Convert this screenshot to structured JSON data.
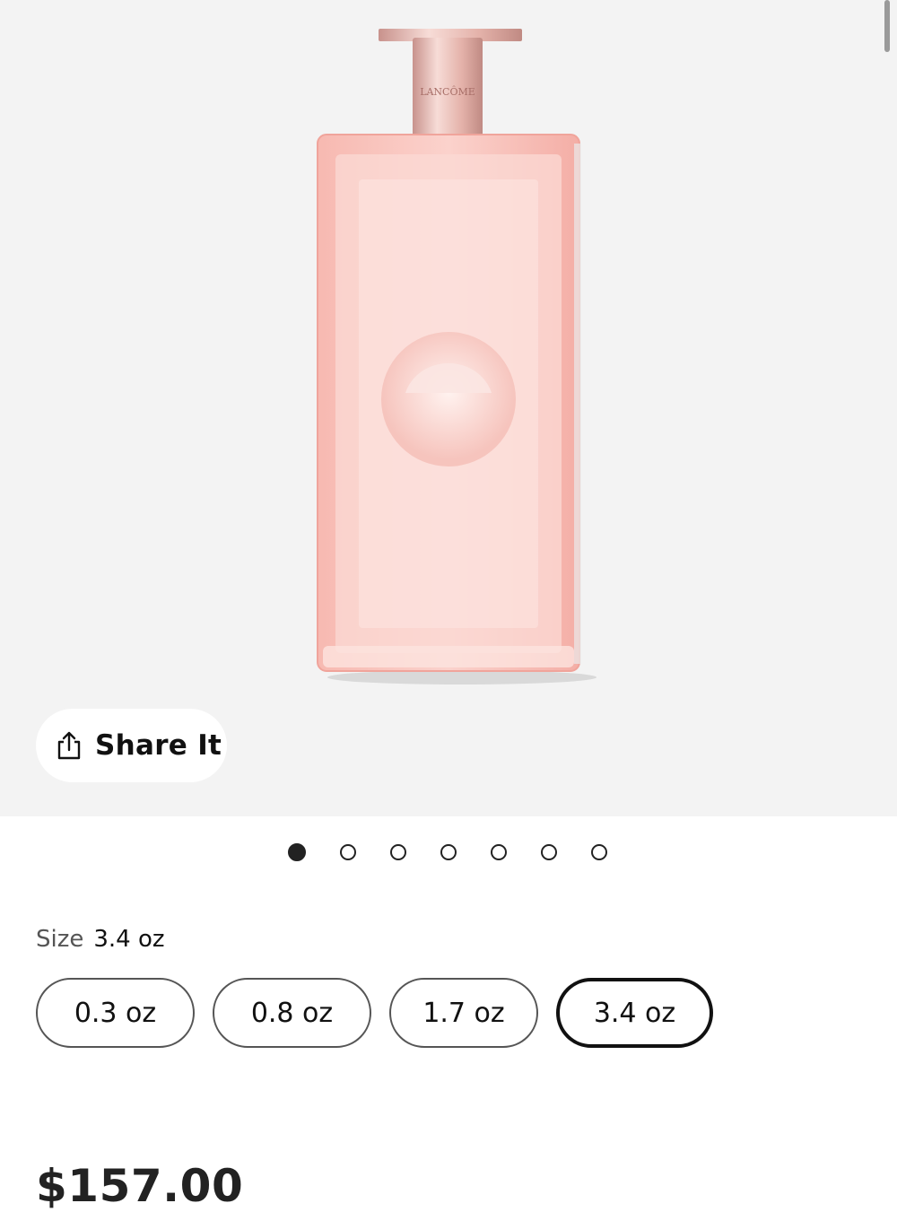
{
  "product": {
    "brand_engraving": "LANCÔME",
    "price": "$157.00"
  },
  "share": {
    "label": "Share It",
    "icon": "share-icon"
  },
  "carousel": {
    "count": 7,
    "active_index": 0
  },
  "size": {
    "label": "Size",
    "selected": "3.4 oz",
    "options": [
      "0.3 oz",
      "0.8 oz",
      "1.7 oz",
      "3.4 oz"
    ]
  },
  "colors": {
    "hero_background": "#f3f3f3",
    "bottle_pink": "#f6b8b2",
    "cap_rose_gold": "#e7b7b0",
    "text": "#111111"
  }
}
